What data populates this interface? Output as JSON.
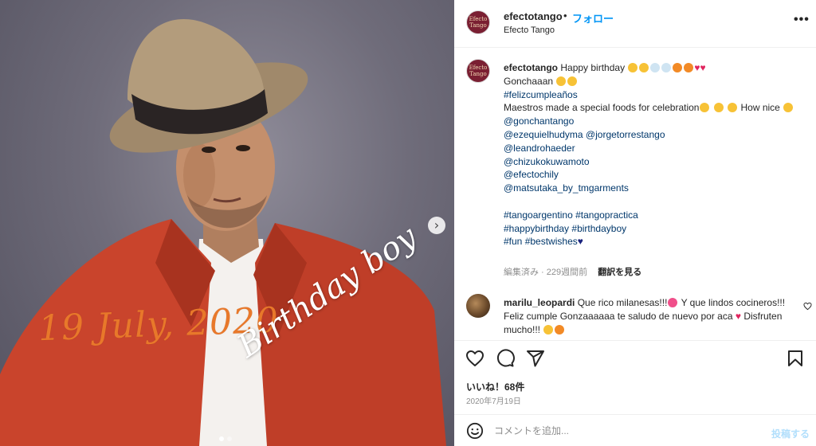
{
  "post": {
    "username": "efectotango",
    "follow_separator": "•",
    "follow_label": "フォロー",
    "subtitle": "Efecto Tango",
    "avatar_text": "Efecto Tango",
    "more_icon": "more-horizontal-icon",
    "photo": {
      "overlay_date": "19 July, 2020",
      "overlay_birthday": "Birthday boy",
      "next_icon": "chevron-right-icon",
      "slide_count": 2,
      "active_slide": 1
    }
  },
  "caption": {
    "username": "efectotango",
    "line1": "Happy birthday",
    "line2": "Gonchaaan",
    "hashtag1": "#felizcumpleaños",
    "line3": "Maestros made a special foods for celebration",
    "line3_end": "How nice",
    "mentions": [
      "@gonchantango",
      "@ezequielhudyma",
      "@jorgetorrestango",
      "@leandrohaeder",
      "@chizukokuwamoto",
      "@efectochily",
      "@matsutaka_by_tmgarments"
    ],
    "hashtags": [
      "#tangoargentino",
      "#tangopractica",
      "#happybirthday",
      "#birthdayboy",
      "#fun",
      "#bestwishes"
    ],
    "edited_label": "編集済み",
    "time_ago": "229週間前",
    "translate_label": "翻訳を見る"
  },
  "comment": {
    "username": "marilu_leopardi",
    "part1": "Que rico milanesas!!!",
    "part2": "Y que lindos cocineros!!! Feliz cumple Gonzaaaaaa te saludo de nuevo por aca",
    "part3": "Disfruten mucho!!!",
    "like_icon": "heart-outline-icon"
  },
  "actions": {
    "like_icon": "heart-outline-icon",
    "comment_icon": "comment-bubble-icon",
    "share_icon": "paper-plane-icon",
    "save_icon": "bookmark-icon"
  },
  "likes_text": "いいね！68件",
  "date_text": "2020年7月19日",
  "add_comment": {
    "placeholder": "コメントを追加...",
    "post_label": "投稿する",
    "emoji_icon": "smiley-icon"
  },
  "colors": {
    "link": "#00376b",
    "follow": "#0095f6",
    "date_overlay": "#e8782a",
    "jacket": "#c9442c"
  }
}
